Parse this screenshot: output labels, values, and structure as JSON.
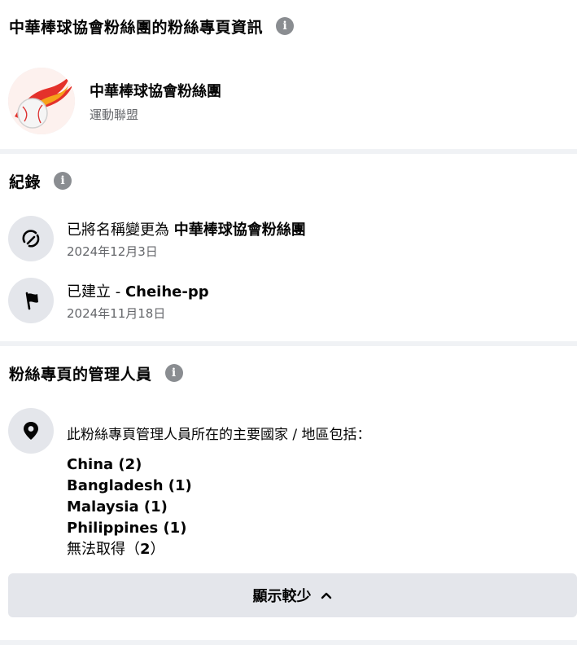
{
  "about": {
    "title": "中華棒球協會粉絲團的粉絲專頁資訊",
    "page_name": "中華棒球協會粉絲團",
    "page_category": "運動聯盟"
  },
  "history": {
    "title": "紀錄",
    "items": [
      {
        "prefix": "已將名稱變更為 ",
        "bold": "中華棒球協會粉絲團",
        "date": "2024年12月3日",
        "icon": "edit-name-icon"
      },
      {
        "prefix": "已建立 - ",
        "bold": "Cheihe-pp",
        "date": "2024年11月18日",
        "icon": "flag-icon"
      }
    ]
  },
  "admins": {
    "title": "粉絲專頁的管理人員",
    "intro": "此粉絲專頁管理人員所在的主要國家 / 地區包括：",
    "countries": [
      "China (2)",
      "Bangladesh (1)",
      "Malaysia (1)",
      "Philippines (1)"
    ],
    "unavailable_label": "無法取得（",
    "unavailable_count": "2",
    "unavailable_close": "）",
    "show_less": "顯示較少"
  },
  "colors": {
    "gray_button": "#e4e6eb",
    "divider": "#f0f2f5",
    "secondary_text": "#65676b"
  }
}
